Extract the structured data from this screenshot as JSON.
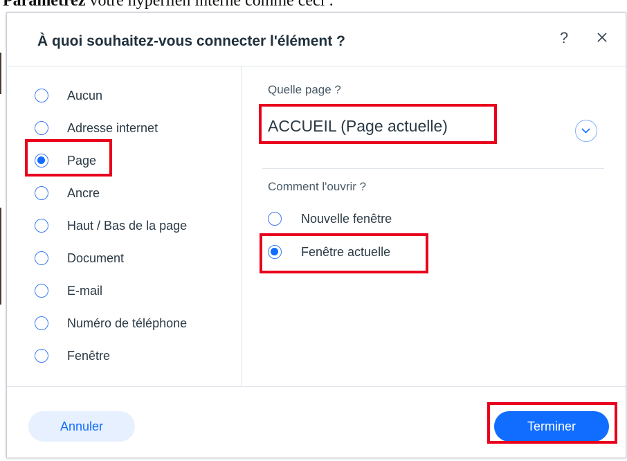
{
  "document": {
    "lead_bold": "Paramétrez",
    "lead_text": " votre hyperlien interne comme ceci :"
  },
  "dialog": {
    "title": "À quoi souhaitez-vous connecter l'élément ?",
    "help_label": "?",
    "link_types": [
      {
        "label": "Aucun",
        "checked": false
      },
      {
        "label": "Adresse internet",
        "checked": false
      },
      {
        "label": "Page",
        "checked": true
      },
      {
        "label": "Ancre",
        "checked": false
      },
      {
        "label": "Haut / Bas de la page",
        "checked": false
      },
      {
        "label": "Document",
        "checked": false
      },
      {
        "label": "E-mail",
        "checked": false
      },
      {
        "label": "Numéro de téléphone",
        "checked": false
      },
      {
        "label": "Fenêtre",
        "checked": false
      }
    ],
    "page_section": {
      "label": "Quelle page ?",
      "selected_page": "ACCUEIL (Page actuelle)"
    },
    "open_section": {
      "label": "Comment l'ouvrir ?",
      "options": [
        {
          "label": "Nouvelle fenêtre",
          "checked": false
        },
        {
          "label": "Fenêtre actuelle",
          "checked": true
        }
      ]
    },
    "footer": {
      "cancel_label": "Annuler",
      "done_label": "Terminer"
    }
  },
  "colors": {
    "accent": "#116dff",
    "highlight": "#e8001c",
    "cancel_bg": "#e7f0ff"
  },
  "icons": {
    "close": "close-icon",
    "dropdown": "chevron-down-icon"
  }
}
